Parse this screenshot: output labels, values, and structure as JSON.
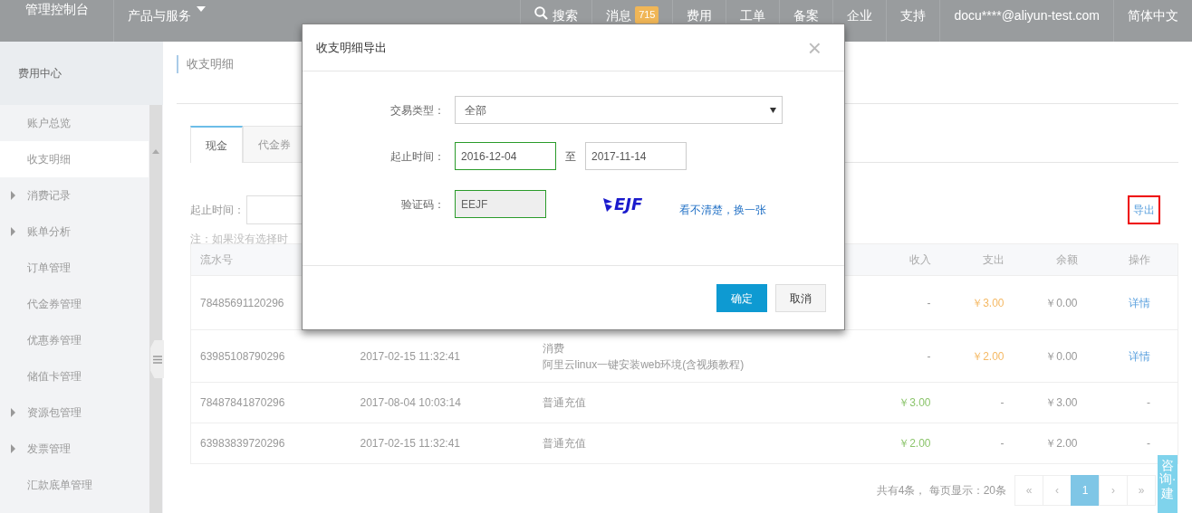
{
  "topnav": {
    "brand": "管理控制台",
    "products": "产品与服务",
    "search": "搜索",
    "messages": {
      "label": "消息",
      "count": "715"
    },
    "links": [
      "费用",
      "工单",
      "备案",
      "企业",
      "支持"
    ],
    "account": "docu****@aliyun-test.com",
    "language": "简体中文"
  },
  "sidebar": {
    "title": "费用中心",
    "items": [
      {
        "label": "账户总览",
        "expandable": false,
        "selected": false
      },
      {
        "label": "收支明细",
        "expandable": false,
        "selected": true
      },
      {
        "label": "消费记录",
        "expandable": true,
        "selected": false
      },
      {
        "label": "账单分析",
        "expandable": true,
        "selected": false
      },
      {
        "label": "订单管理",
        "expandable": false,
        "selected": false
      },
      {
        "label": "代金券管理",
        "expandable": false,
        "selected": false
      },
      {
        "label": "优惠券管理",
        "expandable": false,
        "selected": false
      },
      {
        "label": "储值卡管理",
        "expandable": false,
        "selected": false
      },
      {
        "label": "资源包管理",
        "expandable": true,
        "selected": false
      },
      {
        "label": "发票管理",
        "expandable": true,
        "selected": false
      },
      {
        "label": "汇款底单管理",
        "expandable": false,
        "selected": false
      }
    ]
  },
  "page_title": "收支明细",
  "tabs": [
    {
      "label": "现金",
      "selected": true
    },
    {
      "label": "代金券",
      "selected": false
    }
  ],
  "filter": {
    "label": "起止时间：",
    "note": "注：如果没有选择时",
    "export": "导出"
  },
  "table": {
    "columns": {
      "serial": "流水号",
      "income": "收入",
      "expense": "支出",
      "balance": "余额",
      "action": "操作"
    },
    "rows": [
      {
        "serial": "78485691120296",
        "income": "-",
        "expense": "￥3.00",
        "balance": "￥0.00",
        "action": "详情"
      },
      {
        "serial": "63985108790296",
        "time": "2017-02-15 11:32:41",
        "type": [
          "消费",
          "阿里云linux一键安装web环境(含视频教程)"
        ],
        "income": "-",
        "expense": "￥2.00",
        "balance": "￥0.00",
        "action": "详情"
      },
      {
        "serial": "78487841870296",
        "time": "2017-08-04 10:03:14",
        "type": [
          "普通充值"
        ],
        "income": "￥3.00",
        "expense": "-",
        "balance": "￥3.00",
        "action": "-"
      },
      {
        "serial": "63983839720296",
        "time": "2017-02-15 11:32:41",
        "type": [
          "普通充值"
        ],
        "income": "￥2.00",
        "expense": "-",
        "balance": "￥2.00",
        "action": "-"
      }
    ]
  },
  "pagination": {
    "summary": "共有4条， 每页显示：20条",
    "pages": [
      {
        "label": "«",
        "selected": false
      },
      {
        "label": "‹",
        "selected": false
      },
      {
        "label": "1",
        "selected": true
      },
      {
        "label": "›",
        "selected": false
      },
      {
        "label": "»",
        "selected": false
      }
    ]
  },
  "dialog": {
    "title": "收支明细导出",
    "close": "×",
    "type": {
      "label": "交易类型：",
      "value": "全部"
    },
    "range": {
      "label": "起止时间：",
      "start": {
        "value": "2016-12-04",
        "valid": true
      },
      "separator": "至",
      "end": {
        "value": "2017-11-14",
        "valid": false
      }
    },
    "captcha": {
      "label": "验证码：",
      "value": "EEJF",
      "valid": true,
      "image_text": "EJF",
      "refresh": "看不清楚，换一张"
    },
    "buttons": [
      {
        "label": "确定",
        "kind": "primary"
      },
      {
        "label": "取消",
        "kind": "secondary"
      }
    ]
  },
  "consult_widget": "咨询·建"
}
